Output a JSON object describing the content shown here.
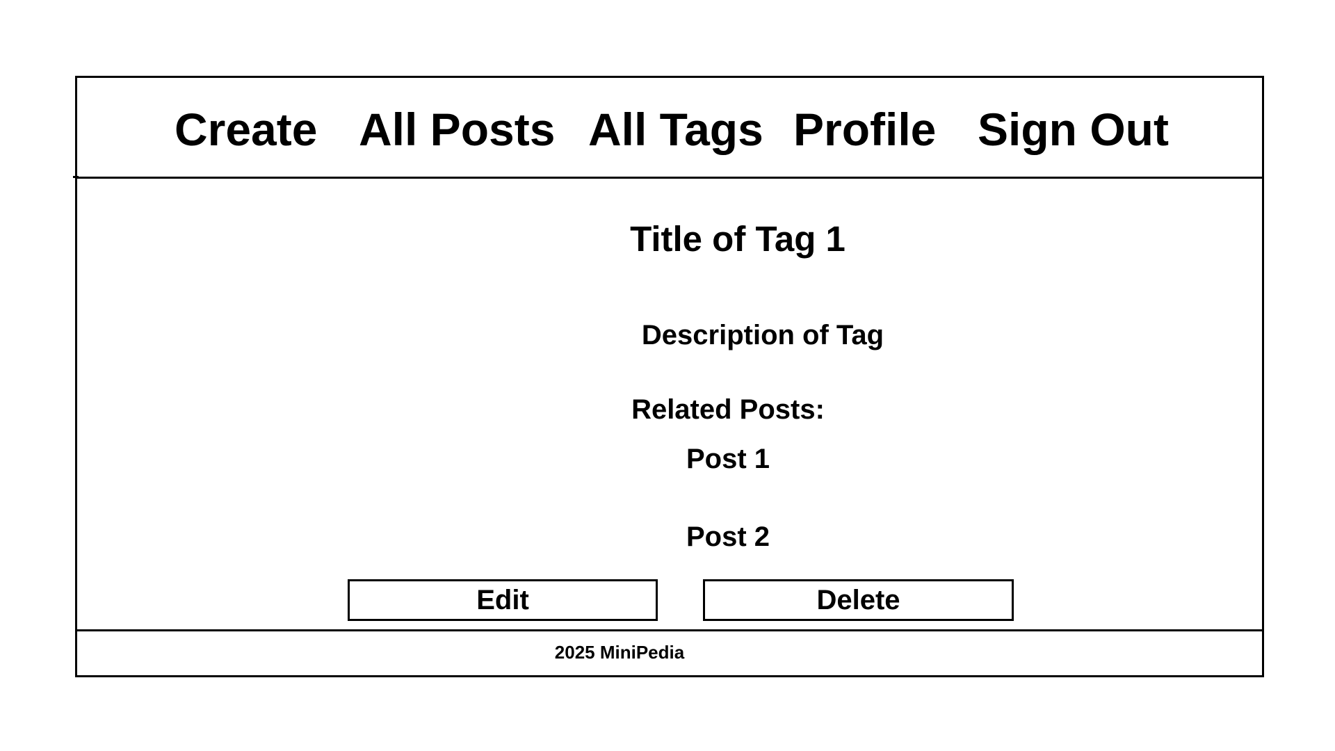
{
  "nav": {
    "create": "Create",
    "all_posts": "All Posts",
    "all_tags": "All Tags",
    "profile": "Profile",
    "sign_out": "Sign Out"
  },
  "tag": {
    "title": "Title of Tag 1",
    "description": "Description of Tag"
  },
  "related": {
    "label": "Related Posts:",
    "posts": [
      "Post 1",
      "Post 2"
    ]
  },
  "actions": {
    "edit_label": "Edit",
    "delete_label": "Delete"
  },
  "footer": {
    "text": "2025 MiniPedia"
  }
}
